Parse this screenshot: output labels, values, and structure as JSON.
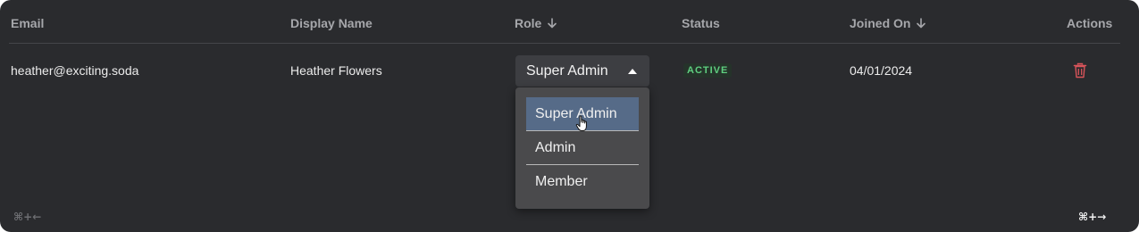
{
  "table": {
    "headers": {
      "email": "Email",
      "display_name": "Display Name",
      "role": "Role",
      "status": "Status",
      "joined_on": "Joined On",
      "actions": "Actions"
    },
    "row": {
      "email": "heather@exciting.soda",
      "display_name": "Heather Flowers",
      "role": "Super Admin",
      "status": "ACTIVE",
      "joined_on": "04/01/2024"
    }
  },
  "role_dropdown": {
    "open": true,
    "options": [
      "Super Admin",
      "Admin",
      "Member"
    ],
    "highlighted": "Super Admin"
  },
  "pagination": {
    "prev_shortcut": "⌘+←",
    "next_shortcut": "⌘+→"
  },
  "icons": {
    "role_sort": "arrow-down-icon",
    "joined_sort": "arrow-down-icon",
    "select_caret": "caret-up-icon",
    "delete": "trash-icon",
    "pointer": "hand-pointer-icon"
  },
  "colors": {
    "background": "#2a2b2e",
    "status_active": "#5fcf80",
    "delete_icon": "#d9545a",
    "option_highlight": "#566b88"
  }
}
